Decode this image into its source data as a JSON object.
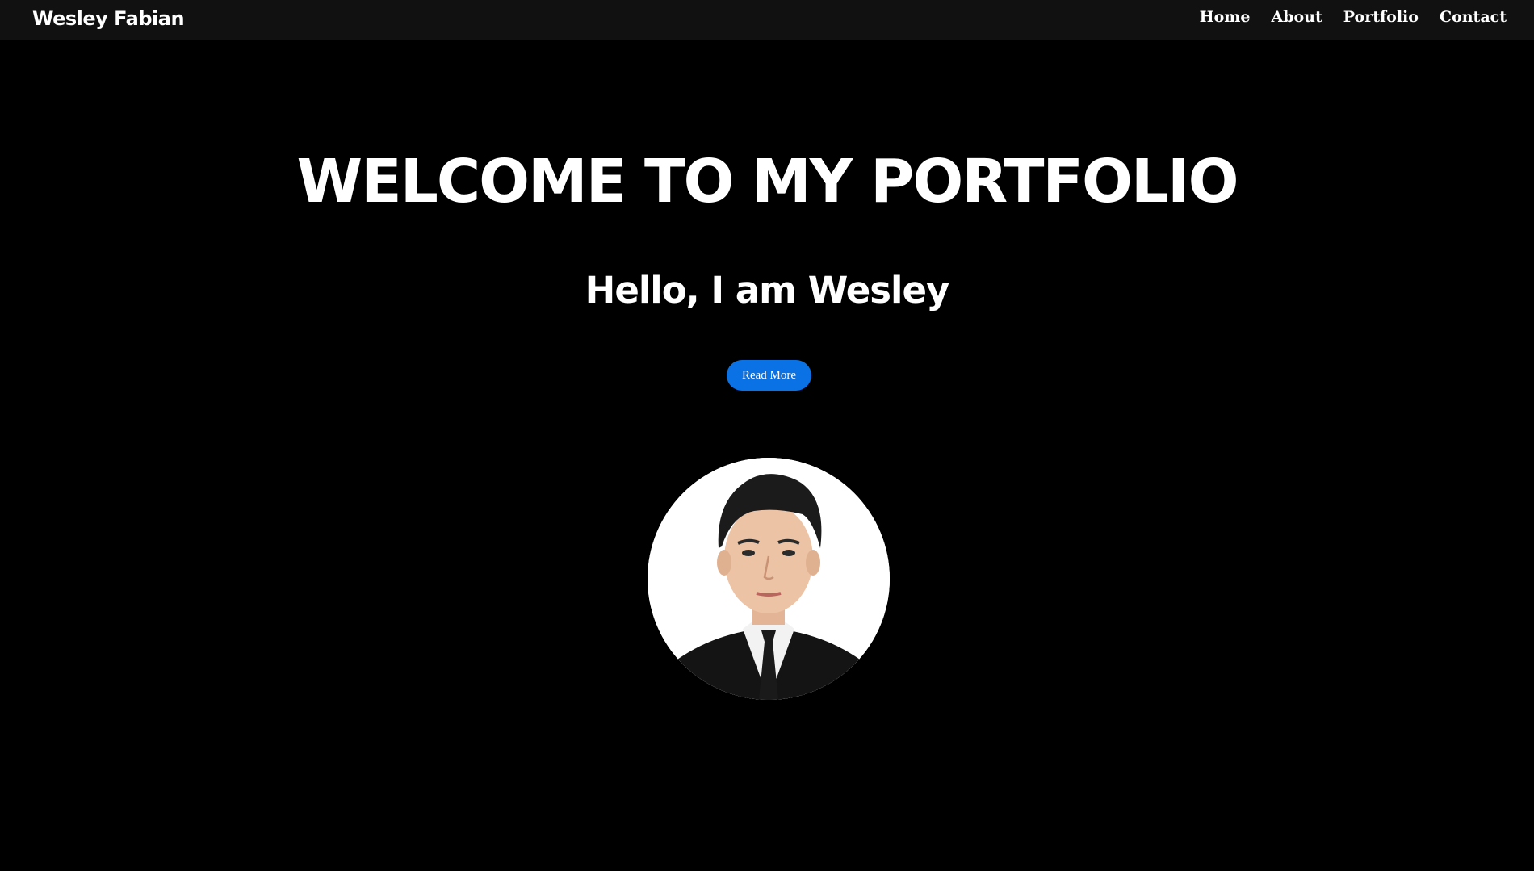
{
  "navbar": {
    "brand": "Wesley Fabian",
    "links": [
      {
        "label": "Home"
      },
      {
        "label": "About"
      },
      {
        "label": "Portfolio"
      },
      {
        "label": "Contact"
      }
    ]
  },
  "hero": {
    "title": "WELCOME TO MY PORTFOLIO",
    "subtitle": "Hello, I am Wesley",
    "button_label": "Read More"
  },
  "colors": {
    "background": "#000000",
    "navbar": "#111111",
    "accent": "#0a72e5",
    "text": "#ffffff"
  }
}
